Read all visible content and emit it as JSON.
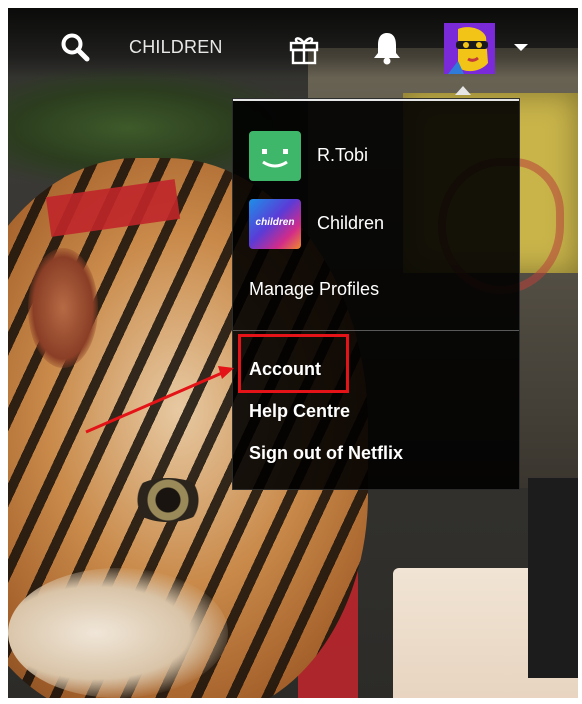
{
  "nav": {
    "children_label": "CHILDREN",
    "icons": {
      "search": "search-icon",
      "gift": "gift-icon",
      "bell": "notification-bell-icon",
      "avatar": "profile-avatar",
      "caret": "caret-down-icon"
    }
  },
  "menu": {
    "profiles": [
      {
        "name": "R.Tobi",
        "avatar": "smiley-profile-icon",
        "avatar_color": "#3fb76b"
      },
      {
        "name": "Children",
        "avatar": "children-profile-icon",
        "avatar_text": "children"
      }
    ],
    "manage_profiles": "Manage Profiles",
    "items": [
      {
        "label": "Account",
        "highlighted": true
      },
      {
        "label": "Help Centre"
      },
      {
        "label": "Sign out of Netflix"
      }
    ]
  },
  "annotation": {
    "highlight_color": "#e41317"
  }
}
